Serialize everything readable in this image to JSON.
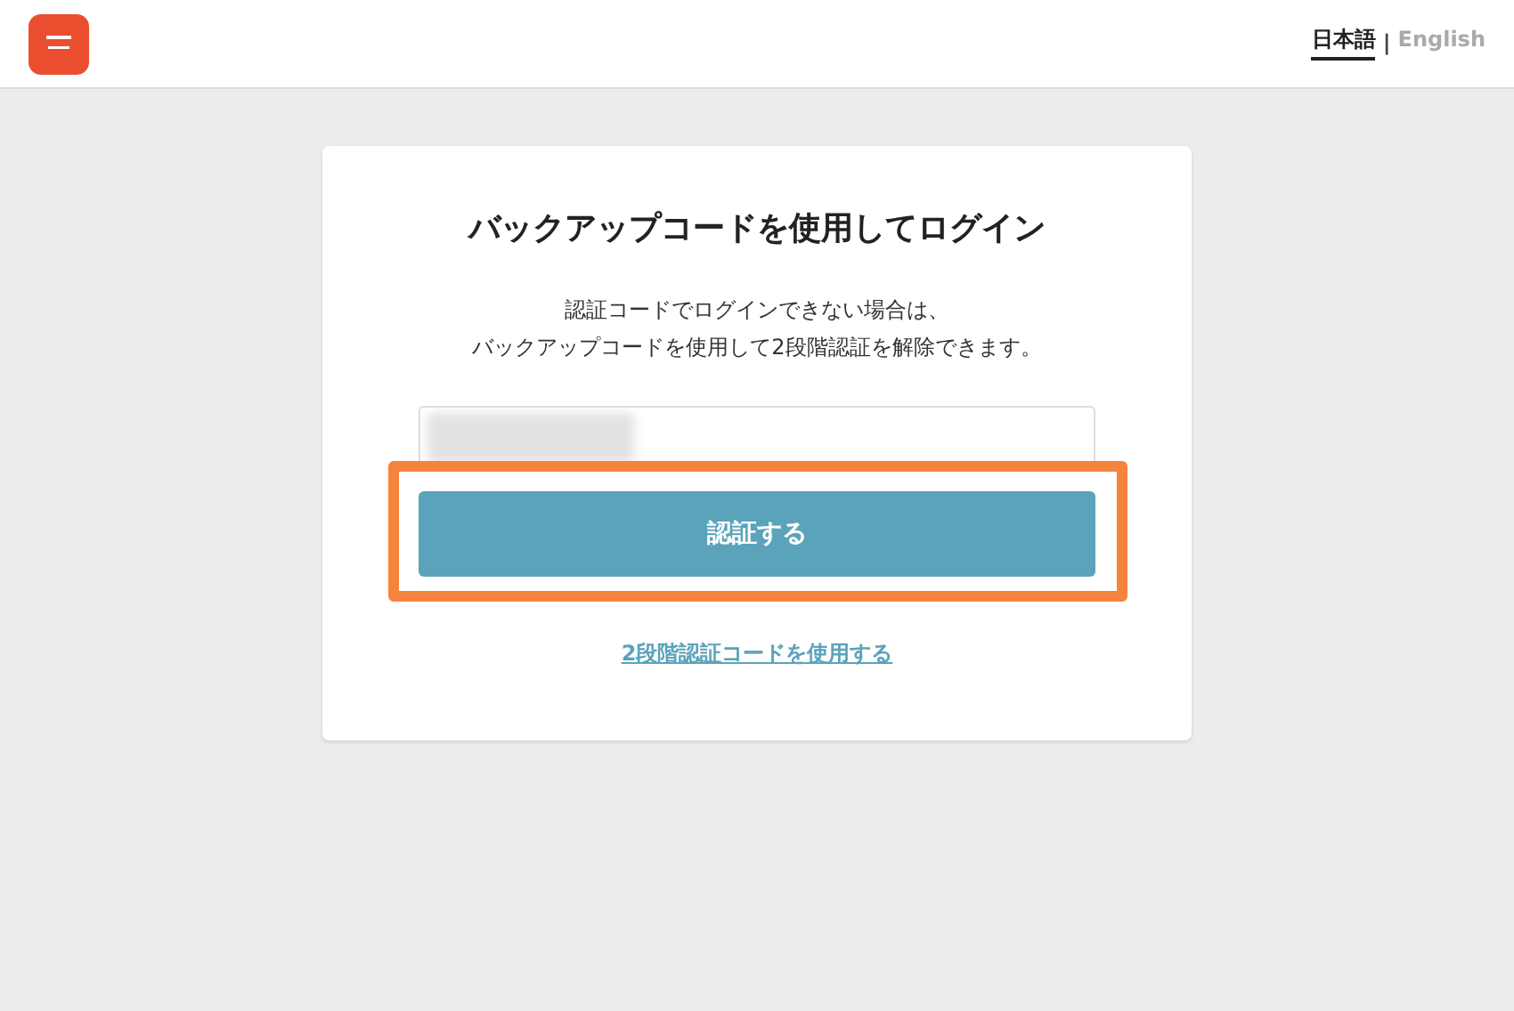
{
  "header": {
    "languages": [
      {
        "label": "日本語",
        "selected": true
      },
      {
        "label": "English",
        "selected": false
      }
    ],
    "separator": "|"
  },
  "card": {
    "title": "バックアップコードを使用してログイン",
    "description": [
      "認証コードでログインできない場合は、",
      "バックアップコードを使用して2段階認証を解除できます。"
    ],
    "code_field": {
      "value_redacted": true
    },
    "submit_button": {
      "label": "認証する",
      "highlighted": true
    },
    "link": "2段階認証コードを使用する"
  }
}
